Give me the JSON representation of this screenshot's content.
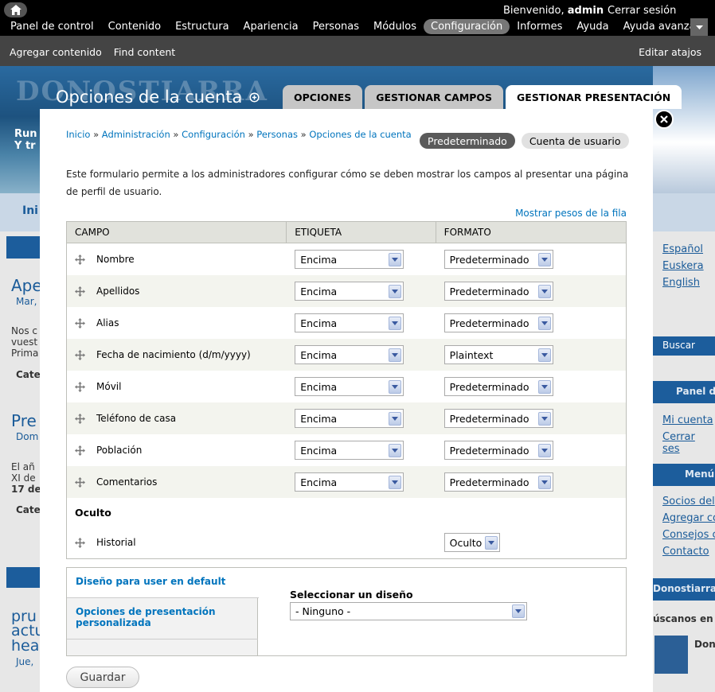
{
  "toolbar": {
    "home_icon": "home-icon",
    "welcome_prefix": "Bienvenido, ",
    "username": "admin",
    "logout": "Cerrar sesión",
    "menu": [
      "Panel de control",
      "Contenido",
      "Estructura",
      "Apariencia",
      "Personas",
      "Módulos",
      "Configuración",
      "Informes",
      "Ayuda",
      "Ayuda avanzada"
    ],
    "active_menu": "Configuración",
    "toggle_icon": "chevron-down-icon",
    "shortcuts": [
      "Agregar contenido",
      "Find content"
    ],
    "edit_shortcuts": "Editar atajos"
  },
  "background_site": {
    "nav_item": "Ini",
    "post1_title": "Ape",
    "post1_date": "Mar,",
    "post1_text": [
      "Nos c",
      "vuest",
      "Prima"
    ],
    "category": "Cate",
    "post2_title": "Pre",
    "post2_date": "Dom",
    "post2_text": [
      "El añ",
      "XI de",
      "17 de"
    ],
    "post3_title": [
      "pru",
      "actu",
      "hea"
    ],
    "post3_date": "Jue,",
    "langs": [
      "Español",
      "Euskera",
      "English"
    ],
    "search_btn": "Buscar",
    "panel_title": "Panel de",
    "panel_links": [
      "Mi cuenta",
      "Cerrar ses"
    ],
    "menu_title": "Menú",
    "menu_links": [
      "Socios del",
      "Agregar co",
      "Consejos c",
      "Contacto"
    ],
    "club_title": "Donostiarra",
    "find_us": "úscanos en",
    "fb_name": "Don"
  },
  "modal": {
    "title": "Opciones de la cuenta",
    "title_icon": "plus-circle-icon",
    "tabs": [
      {
        "label": "OPCIONES",
        "active": false
      },
      {
        "label": "GESTIONAR CAMPOS",
        "active": false
      },
      {
        "label": "GESTIONAR PRESENTACIÓN",
        "active": true
      }
    ],
    "close_icon": "close-icon",
    "breadcrumb": [
      "Inicio",
      "Administración",
      "Configuración",
      "Personas",
      "Opciones de la cuenta"
    ],
    "breadcrumb_sep": "»",
    "subtabs": [
      {
        "label": "Predeterminado",
        "active": true
      },
      {
        "label": "Cuenta de usuario",
        "active": false
      }
    ],
    "description": "Este formulario permite a los administradores configurar cómo se deben mostrar los campos al presentar una página de perfil de usuario.",
    "show_weights": "Mostrar pesos de la fila",
    "table": {
      "headers": [
        "CAMPO",
        "ETIQUETA",
        "FORMATO"
      ],
      "rows": [
        {
          "field": "Nombre",
          "label": "Encima",
          "format": "Predeterminado"
        },
        {
          "field": "Apellidos",
          "label": "Encima",
          "format": "Predeterminado"
        },
        {
          "field": "Alias",
          "label": "Encima",
          "format": "Predeterminado"
        },
        {
          "field": "Fecha de nacimiento (d/m/yyyy)",
          "label": "Encima",
          "format": "Plaintext"
        },
        {
          "field": "Móvil",
          "label": "Encima",
          "format": "Predeterminado"
        },
        {
          "field": "Teléfono de casa",
          "label": "Encima",
          "format": "Predeterminado"
        },
        {
          "field": "Población",
          "label": "Encima",
          "format": "Predeterminado"
        },
        {
          "field": "Comentarios",
          "label": "Encima",
          "format": "Predeterminado"
        }
      ],
      "hidden_region": "Oculto",
      "hidden_rows": [
        {
          "field": "Historial",
          "format": "Oculto"
        }
      ]
    },
    "layout": {
      "vtabs": [
        "Diseño para user en default",
        "Opciones de presentación personalizada"
      ],
      "select_label": "Seleccionar un diseño",
      "select_value": "- Ninguno -"
    },
    "save": "Guardar"
  }
}
